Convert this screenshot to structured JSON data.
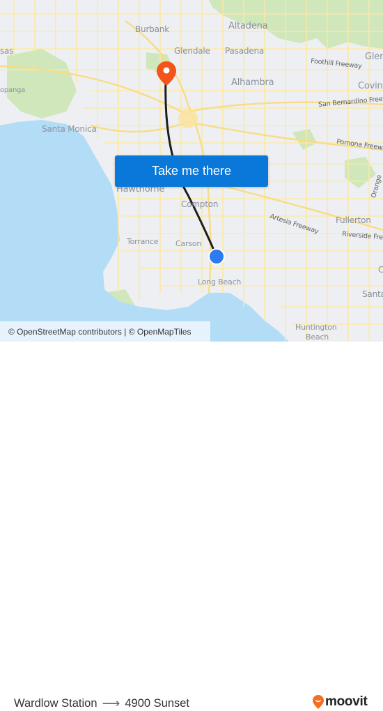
{
  "map": {
    "places": [
      {
        "name": "Burbank",
        "cls": ""
      },
      {
        "name": "Altadena",
        "cls": ""
      },
      {
        "name": "Glendale",
        "cls": ""
      },
      {
        "name": "Pasadena",
        "cls": ""
      },
      {
        "name": "Glen",
        "cls": ""
      },
      {
        "name": "Alhambra",
        "cls": ""
      },
      {
        "name": "Covina",
        "cls": ""
      },
      {
        "name": "sas",
        "cls": ""
      },
      {
        "name": "opanga",
        "cls": ""
      },
      {
        "name": "Santa Monica",
        "cls": ""
      },
      {
        "name": "Hawthorne",
        "cls": ""
      },
      {
        "name": "Compton",
        "cls": ""
      },
      {
        "name": "Fullerton",
        "cls": ""
      },
      {
        "name": "Torrance",
        "cls": ""
      },
      {
        "name": "Carson",
        "cls": ""
      },
      {
        "name": "Long Beach",
        "cls": ""
      },
      {
        "name": "Santa",
        "cls": ""
      },
      {
        "name": "Huntington",
        "cls": ""
      },
      {
        "name": "Beach",
        "cls": ""
      },
      {
        "name": "C",
        "cls": ""
      }
    ],
    "roads": [
      "Foothill Freeway",
      "San Bernardino Freeway",
      "Pomona Freeway",
      "Artesia Freeway",
      "Riverside Freeway",
      "Orange"
    ],
    "colors": {
      "water": "#b3dcf7",
      "land": "#eeeff2",
      "park": "#cde6b9",
      "road": "#fbe9a6",
      "route": "#1e1e1e",
      "destination_pin": "#f3541c",
      "origin_dot": "#2b7cf0"
    }
  },
  "cta": {
    "label": "Take me there",
    "color": "#0a78d8"
  },
  "attribution": "© OpenStreetMap contributors | © OpenMapTiles",
  "footer": {
    "origin": "Wardlow Station",
    "arrow": "⟶",
    "destination": "4900 Sunset",
    "logo_text": "moovit",
    "logo_color": "#f36f21"
  }
}
